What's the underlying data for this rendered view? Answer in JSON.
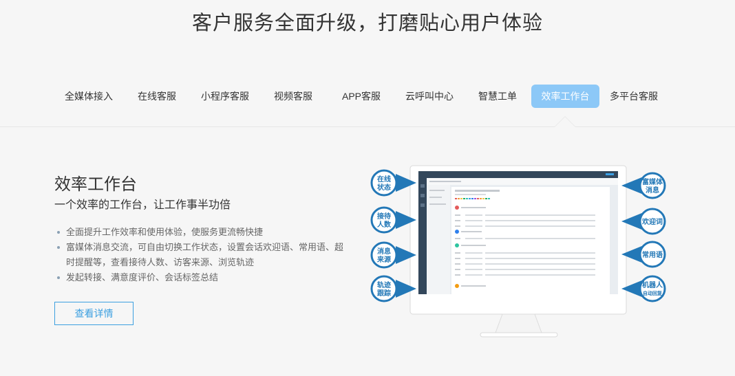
{
  "hero": {
    "title": "客户服务全面升级，打磨贴心用户体验"
  },
  "tabs": [
    {
      "label": "全媒体接入",
      "active": false
    },
    {
      "label": "在线客服",
      "active": false
    },
    {
      "label": "小程序客服",
      "active": false
    },
    {
      "label": "视频客服",
      "active": false
    },
    {
      "label": "APP客服",
      "active": false
    },
    {
      "label": "云呼叫中心",
      "active": false
    },
    {
      "label": "智慧工单",
      "active": false
    },
    {
      "label": "效率工作台",
      "active": true
    },
    {
      "label": "多平台客服",
      "active": false
    }
  ],
  "section": {
    "title": "效率工作台",
    "subtitle": "一个效率的工作台，让工作事半功倍",
    "features": [
      "全面提升工作效率和使用体验，使服务更流畅快捷",
      "富媒体消息交流，可自由切换工作状态，设置会话欢迎语、常用语、超时提醒等，查看接待人数、访客来源、浏览轨迹",
      "发起转接、满意度评价、会话标签总结"
    ],
    "button_label": "查看详情"
  },
  "illustration": {
    "left_badges": [
      {
        "line1": "在线",
        "line2": "状态"
      },
      {
        "line1": "接待",
        "line2": "人数"
      },
      {
        "line1": "消息",
        "line2": "来源"
      },
      {
        "line1": "轨迹",
        "line2": "跟踪"
      }
    ],
    "right_badges": [
      {
        "line1": "富媒体",
        "line2": "消息"
      },
      {
        "line1": "欢迎词",
        "line2": ""
      },
      {
        "line1": "常用语",
        "line2": ""
      },
      {
        "line1": "机器人",
        "line2": "自动回复"
      }
    ],
    "colors": {
      "badge": "#2378b7",
      "screen_dark": "#33475b",
      "accent": "#3ba0e6"
    }
  }
}
